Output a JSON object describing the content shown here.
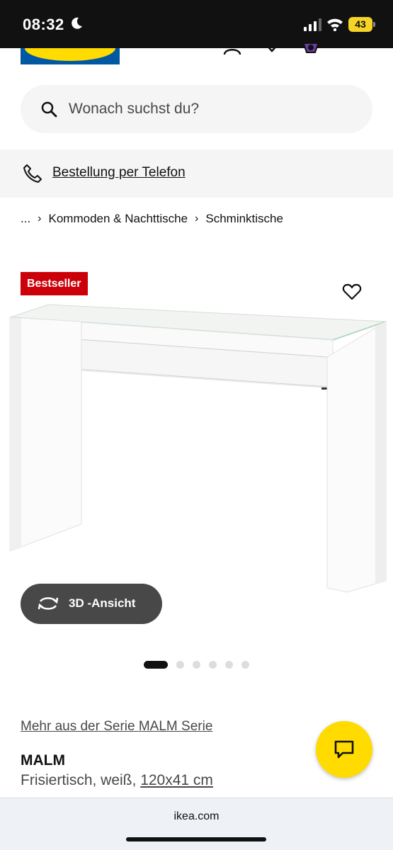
{
  "status_bar": {
    "time": "08:32",
    "battery": "43"
  },
  "search": {
    "placeholder": "Wonach suchst du?"
  },
  "phone_banner": {
    "label": "Bestellung per Telefon"
  },
  "breadcrumb": {
    "ellipsis": "...",
    "items": [
      "Kommoden & Nachttische",
      "Schminktische"
    ]
  },
  "badge": {
    "label": "Bestseller"
  },
  "button_3d": {
    "label": "3D -Ansicht"
  },
  "carousel": {
    "total": 6,
    "active": 1
  },
  "series_link": {
    "label": "Mehr aus der Serie MALM Serie"
  },
  "product": {
    "name": "MALM",
    "description": "Frisiertisch, weiß,",
    "size": "120x41 cm"
  },
  "browser": {
    "url": "ikea.com"
  },
  "colors": {
    "brand_blue": "#0058a3",
    "brand_yellow": "#ffdb00",
    "badge_red": "#cc0008",
    "dark": "#111111"
  },
  "icons": [
    "moon-icon",
    "signal-icon",
    "wifi-icon",
    "account-icon",
    "heart-icon",
    "cart-icon",
    "menu-icon",
    "search-icon",
    "phone-icon",
    "rotate-icon",
    "chat-icon"
  ]
}
